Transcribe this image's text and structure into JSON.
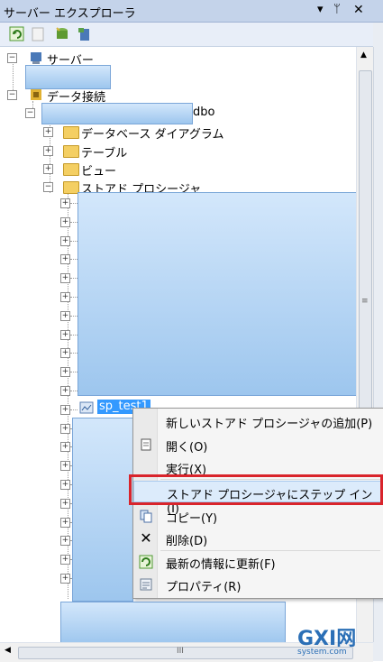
{
  "window": {
    "title": "サーバー エクスプローラ",
    "pin_glyph": "▾ ᛘ",
    "close_glyph": "✕"
  },
  "toolbar": {
    "buttons": [
      "refresh-icon",
      "stop-icon",
      "connect-database-icon",
      "connect-server-icon"
    ]
  },
  "tree": {
    "servers": {
      "label": "サーバー"
    },
    "data_connections": {
      "label": "データ接続"
    },
    "connection_suffix": "dbo",
    "children": [
      {
        "label": "データベース ダイアグラム"
      },
      {
        "label": "テーブル"
      },
      {
        "label": "ビュー"
      },
      {
        "label": "ストアド プロシージャ"
      }
    ],
    "selected_item": "sp_test1"
  },
  "context_menu": {
    "items": [
      {
        "label": "新しいストアド プロシージャの追加(P)",
        "icon": ""
      },
      {
        "label": "開く(O)",
        "icon": "open-icon"
      },
      {
        "label": "実行(X)",
        "icon": ""
      },
      {
        "label": "ストアド プロシージャにステップ イン(I)",
        "icon": "",
        "highlighted": true
      },
      {
        "label": "コピー(Y)",
        "icon": "copy-icon"
      },
      {
        "label": "削除(D)",
        "icon": "delete-icon"
      },
      {
        "label": "最新の情報に更新(F)",
        "icon": "refresh-icon"
      },
      {
        "label": "プロパティ(R)",
        "icon": "properties-icon"
      }
    ]
  },
  "hscroll_label": "III",
  "vscroll_grip": "≡",
  "watermark": {
    "text": "GXI网",
    "sub": "system.com"
  }
}
